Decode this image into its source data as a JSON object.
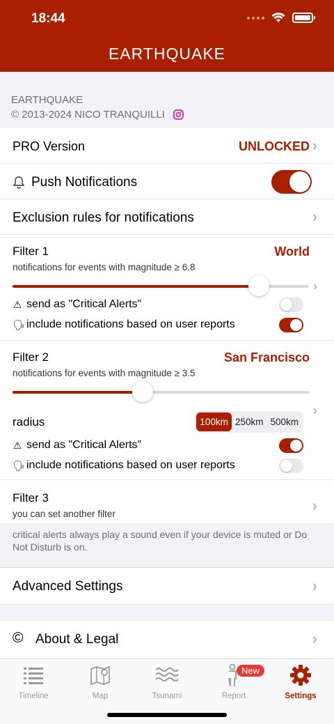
{
  "status_bar": {
    "time": "18:44"
  },
  "nav": {
    "title": "EARTHQUAKE"
  },
  "app_info": {
    "name": "EARTHQUAKE",
    "copyright": "© 2013-2024 NICO TRANQUILLI"
  },
  "settings": {
    "pro": {
      "label": "PRO Version",
      "value": "UNLOCKED"
    },
    "push": {
      "label": "Push Notifications",
      "enabled": true
    },
    "exclusion": {
      "label": "Exclusion rules for notifications"
    },
    "filter1": {
      "title": "Filter 1",
      "value": "World",
      "subtitle": "notifications for events with magnitude ≥ 6.8",
      "slider_fraction": 0.83,
      "critical_label": "send as \"Critical Alerts\"",
      "critical_on": false,
      "reports_label": "include notifications based on user reports",
      "reports_on": true
    },
    "filter2": {
      "title": "Filter 2",
      "value": "San Francisco",
      "subtitle": "notifications for events with magnitude ≥ 3.5",
      "slider_fraction": 0.44,
      "radius_label": "radius",
      "radius_options": [
        "100km",
        "250km",
        "500km"
      ],
      "radius_selected": "100km",
      "critical_label": "send as \"Critical Alerts\"",
      "critical_on": true,
      "reports_label": "include notifications based on user reports",
      "reports_on": false
    },
    "filter3": {
      "title": "Filter 3",
      "subtitle": "you can set another filter"
    },
    "footer_note": "critical alerts always play a sound even if your device is muted or Do Not Disturb is on.",
    "advanced": {
      "label": "Advanced Settings"
    },
    "about": {
      "label": "About & Legal",
      "icon_glyph": "©"
    }
  },
  "tabs": [
    {
      "label": "Timeline",
      "icon": "list-icon"
    },
    {
      "label": "Map",
      "icon": "map-icon"
    },
    {
      "label": "Tsunami",
      "icon": "waves-icon"
    },
    {
      "label": "Report",
      "icon": "person-report-icon",
      "badge": "New"
    },
    {
      "label": "Settings",
      "icon": "gear-icon",
      "active": true
    }
  ],
  "colors": {
    "accent": "#a82000",
    "background": "#f2f2f7"
  }
}
